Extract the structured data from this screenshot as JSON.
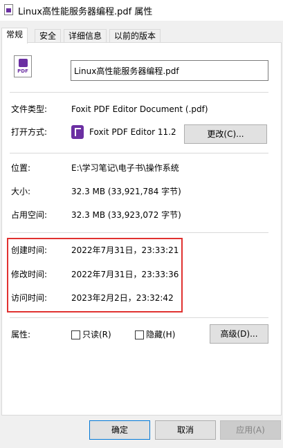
{
  "window": {
    "title": "Linux高性能服务器编程.pdf 属性"
  },
  "tabs": [
    "常规",
    "安全",
    "详细信息",
    "以前的版本"
  ],
  "general": {
    "file_icon_ext": "PDF",
    "filename": "Linux高性能服务器编程.pdf",
    "file_type_label": "文件类型:",
    "file_type_value": "Foxit PDF Editor Document (.pdf)",
    "open_with_label": "打开方式:",
    "open_with_value": "Foxit PDF Editor 11.2",
    "change_button": "更改(C)...",
    "location_label": "位置:",
    "location_value": "E:\\学习笔记\\电子书\\操作系统",
    "size_label": "大小:",
    "size_value": "32.3 MB (33,921,784 字节)",
    "size_on_disk_label": "占用空间:",
    "size_on_disk_value": "32.3 MB (33,923,072 字节)",
    "created_label": "创建时间:",
    "created_value": "2022年7月31日，23:33:21",
    "modified_label": "修改时间:",
    "modified_value": "2022年7月31日，23:33:36",
    "accessed_label": "访问时间:",
    "accessed_value": "2023年2月2日，23:32:42",
    "attributes_label": "属性:",
    "readonly_label": "只读(R)",
    "hidden_label": "隐藏(H)",
    "advanced_button": "高级(D)..."
  },
  "footer": {
    "ok": "确定",
    "cancel": "取消",
    "apply": "应用(A)"
  },
  "colors": {
    "highlight": "#e0312f",
    "foxit_brand": "#6b2fa2",
    "primary_border": "#0078d7"
  }
}
